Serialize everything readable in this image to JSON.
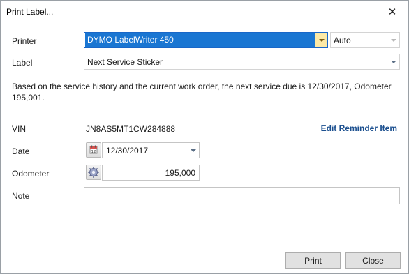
{
  "window": {
    "title": "Print Label...",
    "close_glyph": "✕"
  },
  "form": {
    "printer_label": "Printer",
    "printer_value": "DYMO LabelWriter 450",
    "tray_value": "Auto",
    "label_label": "Label",
    "label_value": "Next Service Sticker",
    "description": "Based on the service history and the current work order, the next service due is 12/30/2017, Odometer 195,001.",
    "vin_label": "VIN",
    "vin_value": "JN8AS5MT1CW284888",
    "edit_link": "Edit Reminder Item",
    "date_label": "Date",
    "date_value": "12/30/2017",
    "odometer_label": "Odometer",
    "odometer_value": "195,000",
    "note_label": "Note",
    "note_value": ""
  },
  "buttons": {
    "print": "Print",
    "close": "Close"
  },
  "icons": {
    "calendar": "calendar-icon",
    "odometer": "gear-icon",
    "dropdown": "chevron-down-icon"
  },
  "colors": {
    "selection": "#1a76d2",
    "link": "#1b4f8f",
    "dropdown_highlight": "#fce9a6"
  }
}
